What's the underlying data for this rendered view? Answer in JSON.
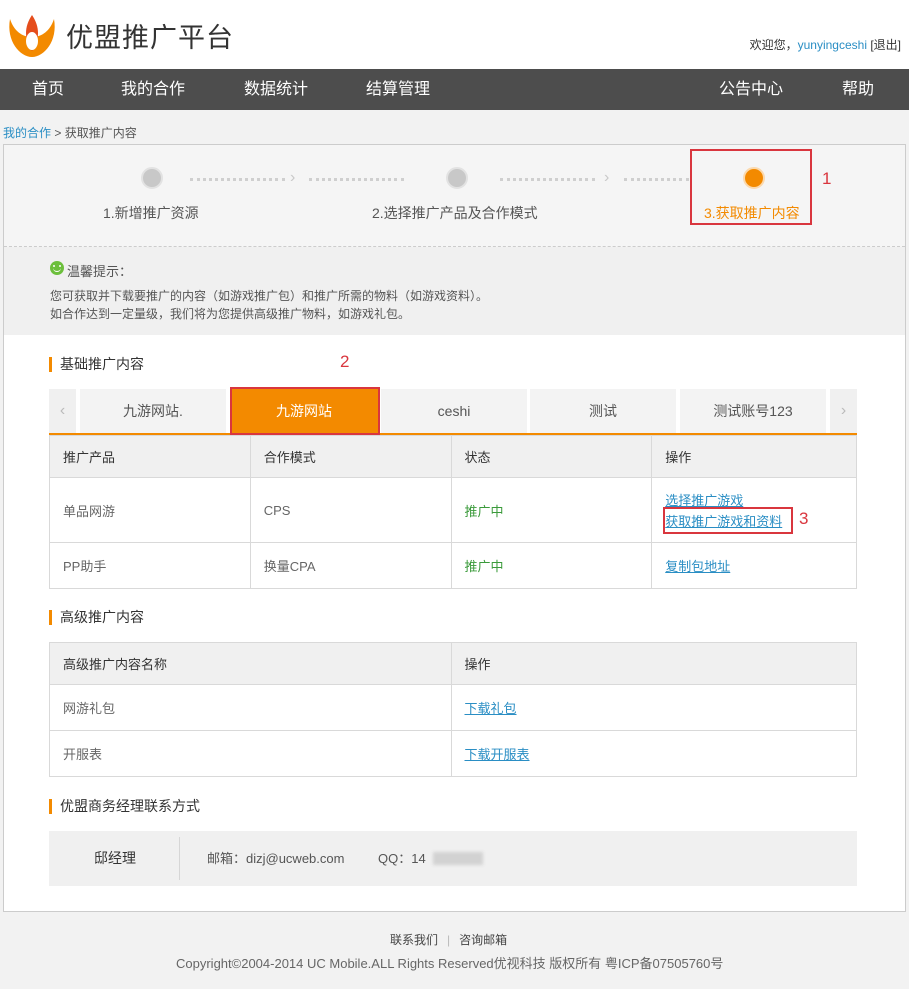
{
  "header": {
    "logo_text": "优盟推广平台",
    "welcome_prefix": "欢迎您，",
    "username": "yunyingceshi",
    "logout": "[退出]"
  },
  "nav": {
    "home": "首页",
    "my_cooperation": "我的合作",
    "statistics": "数据统计",
    "settlement": "结算管理",
    "announcements": "公告中心",
    "help": "帮助"
  },
  "breadcrumb": {
    "parent": "我的合作",
    "separator": " > ",
    "current": "获取推广内容"
  },
  "steps": [
    {
      "label": "1.新增推广资源",
      "active": false
    },
    {
      "label": "2.选择推广产品及合作模式",
      "active": false
    },
    {
      "label": "3.获取推广内容",
      "active": true
    }
  ],
  "annotations": [
    "1",
    "2",
    "3"
  ],
  "tip": {
    "title": "温馨提示：",
    "line1": "您可获取并下载要推广的内容（如游戏推广包）和推广所需的物料（如游戏资料）。",
    "line2": "如合作达到一定量级，我们将为您提供高级推广物料，如游戏礼包。"
  },
  "basic_section": {
    "title": "基础推广内容",
    "tabs": [
      "九游网站.",
      "九游网站",
      "ceshi",
      "测试",
      "测试账号123"
    ],
    "active_tab": 1,
    "prev_arrow": "‹",
    "next_arrow": "›",
    "headers": [
      "推广产品",
      "合作模式",
      "状态",
      "操作"
    ],
    "rows": [
      {
        "product": "单品网游",
        "mode": "CPS",
        "status": "推广中",
        "actions": [
          "选择推广游戏",
          "获取推广游戏和资料"
        ]
      },
      {
        "product": "PP助手",
        "mode": "换量CPA",
        "status": "推广中",
        "actions": [
          "复制包地址"
        ]
      }
    ]
  },
  "advanced_section": {
    "title": "高级推广内容",
    "headers": [
      "高级推广内容名称",
      "操作"
    ],
    "rows": [
      {
        "name": "网游礼包",
        "action": "下载礼包"
      },
      {
        "name": "开服表",
        "action": "下载开服表"
      }
    ]
  },
  "contact_section": {
    "title": "优盟商务经理联系方式",
    "name": "邸经理",
    "email": "邮箱：dizj@ucweb.com",
    "qq": "QQ：14"
  },
  "footer": {
    "contact_us": "联系我们",
    "inquiry_email": "咨询邮箱",
    "copyright": "Copyright©2004-2014 UC Mobile.ALL Rights Reserved优视科技 版权所有 粤ICP备07505760号"
  },
  "colors": {
    "accent": "#f38a00",
    "nav_bg": "#4d4d4d",
    "link": "#2a8ec4",
    "status_green": "#3a9a3a",
    "annotation_red": "#d9363e"
  }
}
